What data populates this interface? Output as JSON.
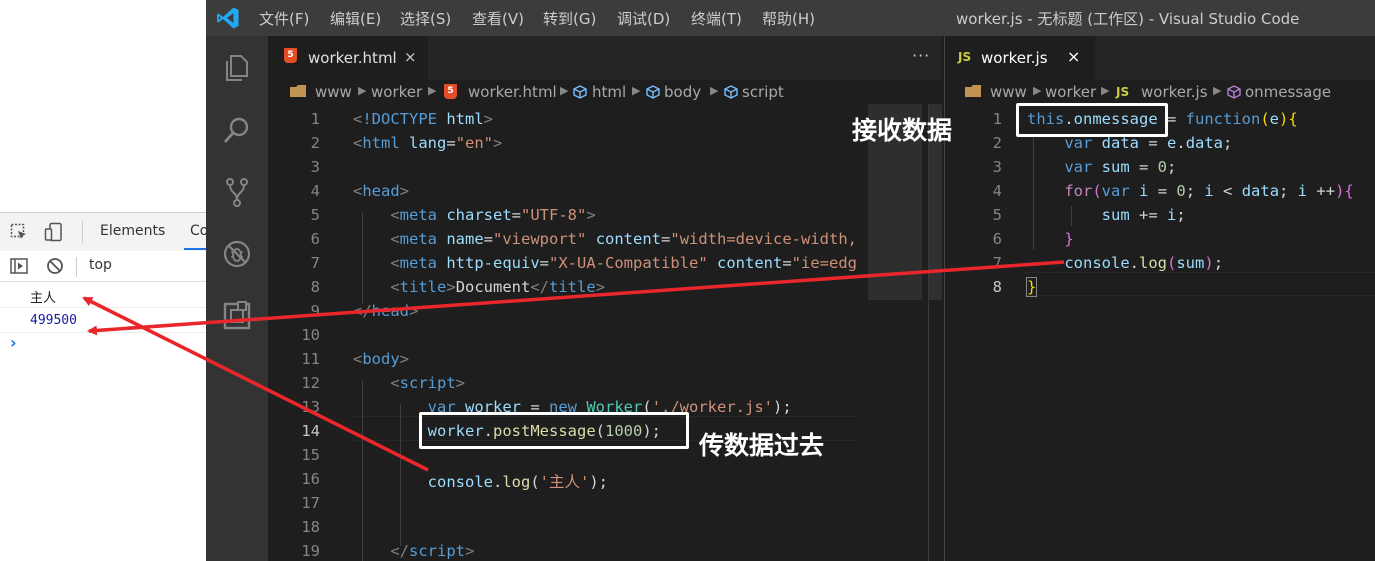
{
  "devtools": {
    "tabs": [
      "Elements",
      "Co"
    ],
    "console_context": "top",
    "console_logs": [
      "主人",
      "499500"
    ],
    "prompt_symbol": "›"
  },
  "vscode": {
    "menu": [
      "文件(F)",
      "编辑(E)",
      "选择(S)",
      "查看(V)",
      "转到(G)",
      "调试(D)",
      "终端(T)",
      "帮助(H)"
    ],
    "window_title": "worker.js - 无标题 (工作区) - Visual Studio Code",
    "left_editor": {
      "tab_label": "worker.html",
      "tab_badge": "5",
      "tab_close": "×",
      "more_actions": "···",
      "breadcrumbs": [
        "www",
        "worker",
        "worker.html",
        "html",
        "body",
        "script"
      ],
      "line_numbers": [
        "1",
        "2",
        "3",
        "4",
        "5",
        "6",
        "7",
        "8",
        "9",
        "10",
        "11",
        "12",
        "13",
        "14",
        "15",
        "16",
        "17",
        "18",
        "19"
      ],
      "active_line": "14"
    },
    "right_editor": {
      "tab_label": "worker.js",
      "tab_badge": "JS",
      "tab_close": "×",
      "breadcrumbs": [
        "www",
        "worker",
        "worker.js",
        "onmessage"
      ],
      "breadcrumb_badge": "JS",
      "line_numbers": [
        "1",
        "2",
        "3",
        "4",
        "5",
        "6",
        "7",
        "8"
      ],
      "active_line": "8"
    }
  },
  "annotations": {
    "receive_label": "接收数据",
    "send_label": "传数据过去",
    "arrow_color": "#e8262b"
  },
  "colors": {
    "titlebar": "#3c3c3c",
    "activitybar": "#333333",
    "editor_bg": "#1e1e1e",
    "tab_bar": "#252526"
  }
}
